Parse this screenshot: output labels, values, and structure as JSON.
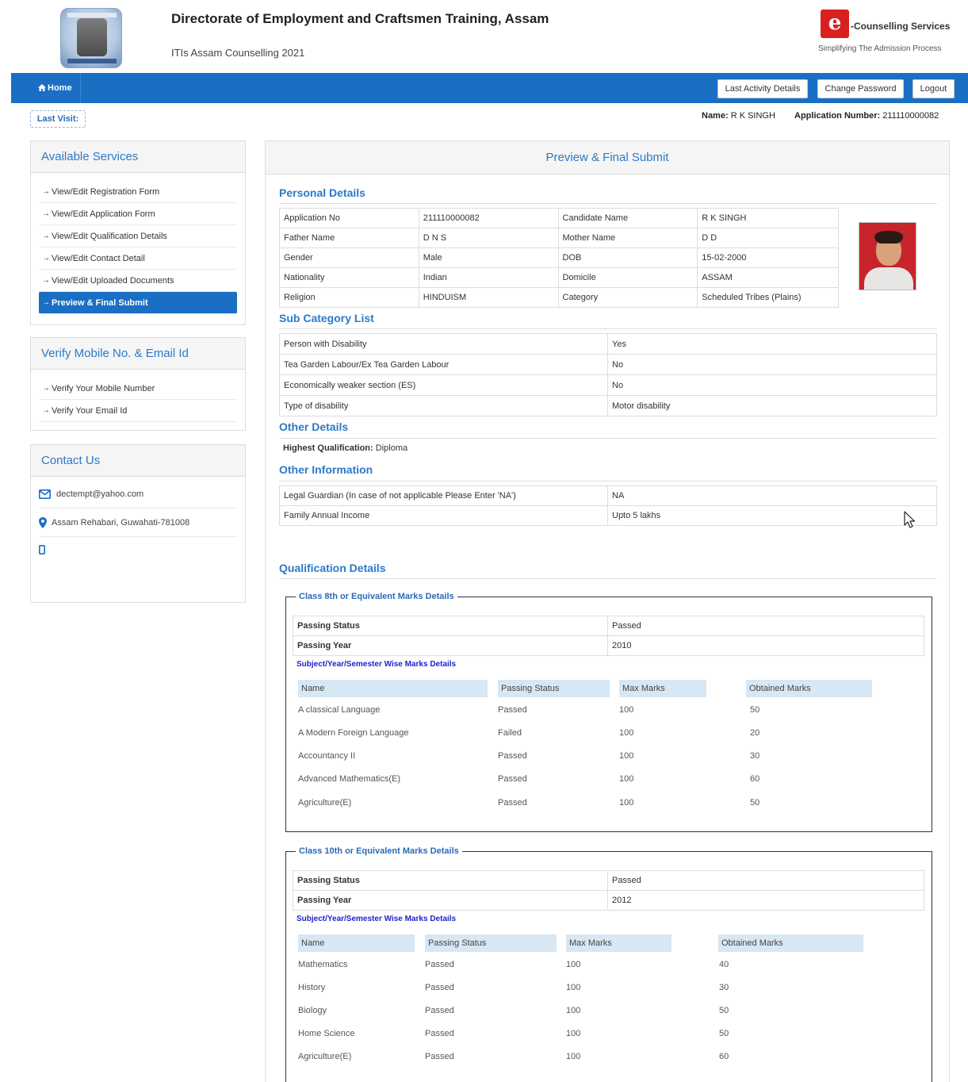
{
  "header": {
    "title": "Directorate of Employment and Craftsmen Training, Assam",
    "subtitle": "ITIs Assam Counselling 2021",
    "brand_name": "-Counselling Services",
    "brand_tagline": "Simplifying The Admission Process",
    "brand_letter": "e"
  },
  "nav": {
    "home": "Home",
    "last_activity": "Last Activity Details",
    "change_password": "Change Password",
    "logout": "Logout"
  },
  "user": {
    "last_visit": "Last Visit:",
    "name_label": "Name:",
    "name": "R K SINGH",
    "appno_label": "Application Number:",
    "appno": "211110000082"
  },
  "services": {
    "title": "Available Services",
    "items": [
      "View/Edit Registration Form",
      "View/Edit Application Form",
      "View/Edit Qualification Details",
      "View/Edit Contact Detail",
      "View/Edit Uploaded Documents",
      "Preview & Final Submit"
    ]
  },
  "verify": {
    "title": "Verify Mobile No. & Email Id",
    "items": [
      "Verify Your Mobile Number",
      "Verify Your Email Id"
    ]
  },
  "contact": {
    "title": "Contact Us",
    "email": "dectempt@yahoo.com",
    "address": "Assam Rehabari, Guwahati-781008"
  },
  "main": {
    "title": "Preview & Final Submit",
    "personal_title": "Personal Details",
    "personal": [
      [
        "Application No",
        "211110000082",
        "Candidate Name",
        "R K SINGH"
      ],
      [
        "Father Name",
        "D N S",
        "Mother Name",
        "D D"
      ],
      [
        "Gender",
        "Male",
        "DOB",
        "15-02-2000"
      ],
      [
        "Nationality",
        "Indian",
        "Domicile",
        "ASSAM"
      ],
      [
        "Religion",
        "HINDUISM",
        "Category",
        "Scheduled Tribes (Plains)"
      ]
    ],
    "subcat_title": "Sub Category List",
    "subcat": [
      [
        "Person with Disability",
        "Yes"
      ],
      [
        "Tea Garden Labour/Ex Tea Garden Labour",
        "No"
      ],
      [
        "Economically weaker section (ES)",
        "No"
      ],
      [
        "Type of disability",
        "Motor disability"
      ]
    ],
    "other_details_title": "Other Details",
    "hq_label": "Highest Qualification:",
    "hq_value": "Diploma",
    "other_info_title": "Other Information",
    "other_info": [
      [
        "Legal Guardian (In case of not applicable Please Enter 'NA')",
        "NA"
      ],
      [
        "Family Annual Income",
        "Upto 5 lakhs"
      ]
    ],
    "qual_title": "Qualification Details"
  },
  "class8": {
    "legend": "Class 8th or Equivalent Marks Details",
    "passing_status_label": "Passing Status",
    "passing_status": "Passed",
    "passing_year_label": "Passing Year",
    "passing_year": "2010",
    "subj_title": "Subject/Year/Semester Wise Marks Details",
    "headers": [
      "Name",
      "Passing Status",
      "Max Marks",
      "Obtained Marks"
    ],
    "rows": [
      [
        "A classical Language",
        "Passed",
        "100",
        "50"
      ],
      [
        "A Modern Foreign Language",
        "Failed",
        "100",
        "20"
      ],
      [
        "Accountancy II",
        "Passed",
        "100",
        "30"
      ],
      [
        "Advanced Mathematics(E)",
        "Passed",
        "100",
        "60"
      ],
      [
        "Agriculture(E)",
        "Passed",
        "100",
        "50"
      ]
    ]
  },
  "class10": {
    "legend": "Class 10th or Equivalent Marks Details",
    "passing_status_label": "Passing Status",
    "passing_status": "Passed",
    "passing_year_label": "Passing Year",
    "passing_year": "2012",
    "subj_title": "Subject/Year/Semester Wise Marks Details",
    "headers": [
      "Name",
      "Passing Status",
      "Max Marks",
      "Obtained Marks"
    ],
    "rows": [
      [
        "Mathematics",
        "Passed",
        "100",
        "40"
      ],
      [
        "History",
        "Passed",
        "100",
        "30"
      ],
      [
        "Biology",
        "Passed",
        "100",
        "50"
      ],
      [
        "Home Science",
        "Passed",
        "100",
        "50"
      ],
      [
        "Agriculture(E)",
        "Passed",
        "100",
        "60"
      ]
    ]
  },
  "icons": {
    "home": "home-icon",
    "arrow": "arrow-right-icon",
    "email": "envelope-icon",
    "location": "map-marker-icon",
    "mobile": "mobile-icon"
  },
  "colors": {
    "primary": "#1a6fc4",
    "link": "#2a7ac8",
    "brand_red": "#d92020"
  }
}
